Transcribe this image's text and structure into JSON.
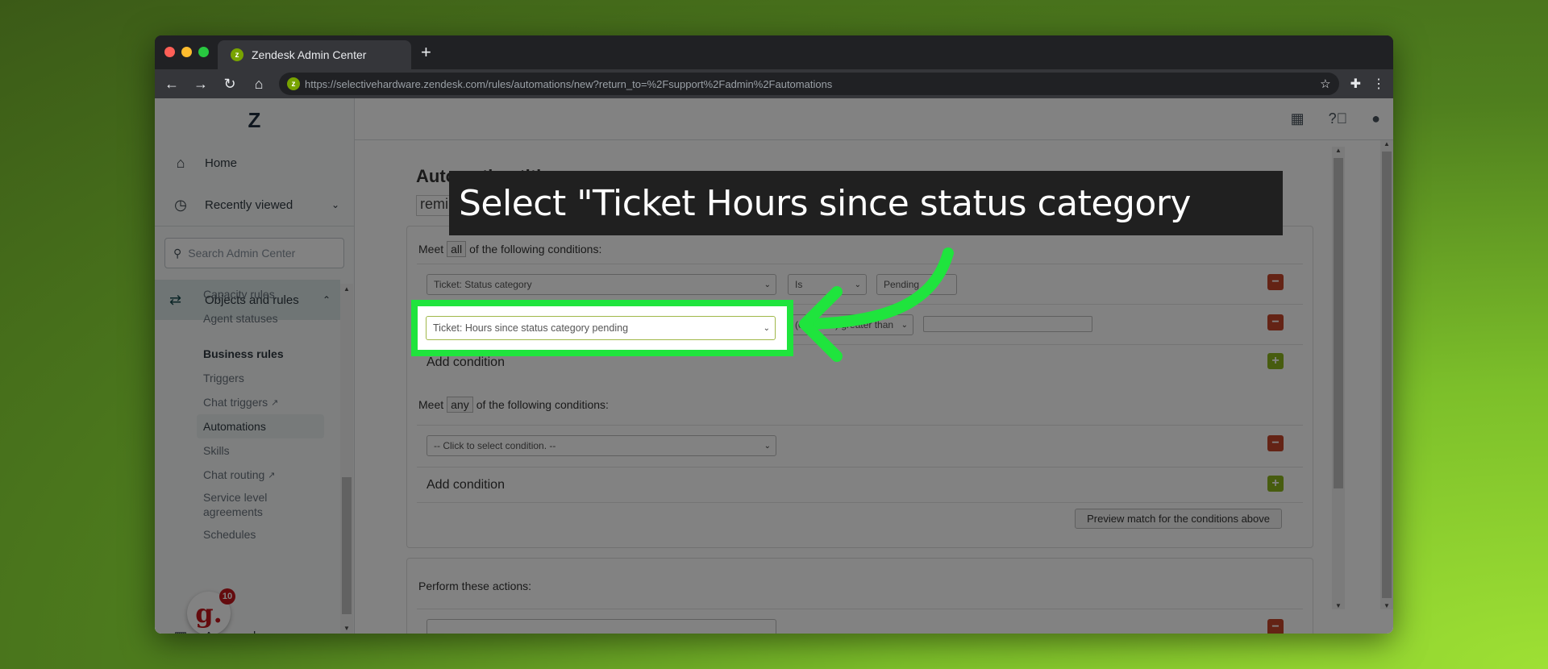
{
  "browser": {
    "tab_title": "Zendesk Admin Center",
    "new_tab": "+",
    "url": "https://selectivehardware.zendesk.com/rules/automations/new?return_to=%2Fsupport%2Fadmin%2Fautomations",
    "traffic_colors": [
      "#ff5f57",
      "#febc2e",
      "#28c840"
    ]
  },
  "sidebar": {
    "logo": "Z",
    "home": "Home",
    "recently_viewed": "Recently viewed",
    "search_placeholder": "Search Admin Center",
    "objects_and_rules": "Objects and rules",
    "sub_items": [
      {
        "label": "Capacity rules"
      },
      {
        "label": "Agent statuses"
      },
      {
        "label": "Business rules"
      },
      {
        "label": "Triggers"
      },
      {
        "label": "Chat triggers"
      },
      {
        "label": "Automations"
      },
      {
        "label": "Skills"
      },
      {
        "label": "Chat routing"
      },
      {
        "label": "Service level agreements"
      },
      {
        "label": "Schedules"
      }
    ],
    "apps": "Apps and integrations",
    "g_badge": "g.",
    "g_count": "10"
  },
  "main": {
    "title_label": "Automation title",
    "title_value": "reminder of outstanding information required",
    "all_conditions": {
      "prefix": "Meet",
      "qualifier": "all",
      "suffix": "of the following conditions:",
      "rows": [
        {
          "field": "Ticket: Status category",
          "operator": "Is",
          "value": "Pending"
        },
        {
          "field": "Ticket: Hours since status category pending",
          "operator": "(calendar) greater than",
          "value": ""
        }
      ],
      "add_label": "Add condition"
    },
    "any_conditions": {
      "prefix": "Meet",
      "qualifier": "any",
      "suffix": "of the following conditions:",
      "rows": [
        {
          "field": "-- Click to select condition. --"
        }
      ],
      "add_label": "Add condition"
    },
    "preview_button": "Preview match for the conditions above",
    "actions_label": "Perform these actions:"
  },
  "overlay": {
    "instruction": "Select \"Ticket Hours since status category",
    "highlight_color": "#1fe43d"
  }
}
